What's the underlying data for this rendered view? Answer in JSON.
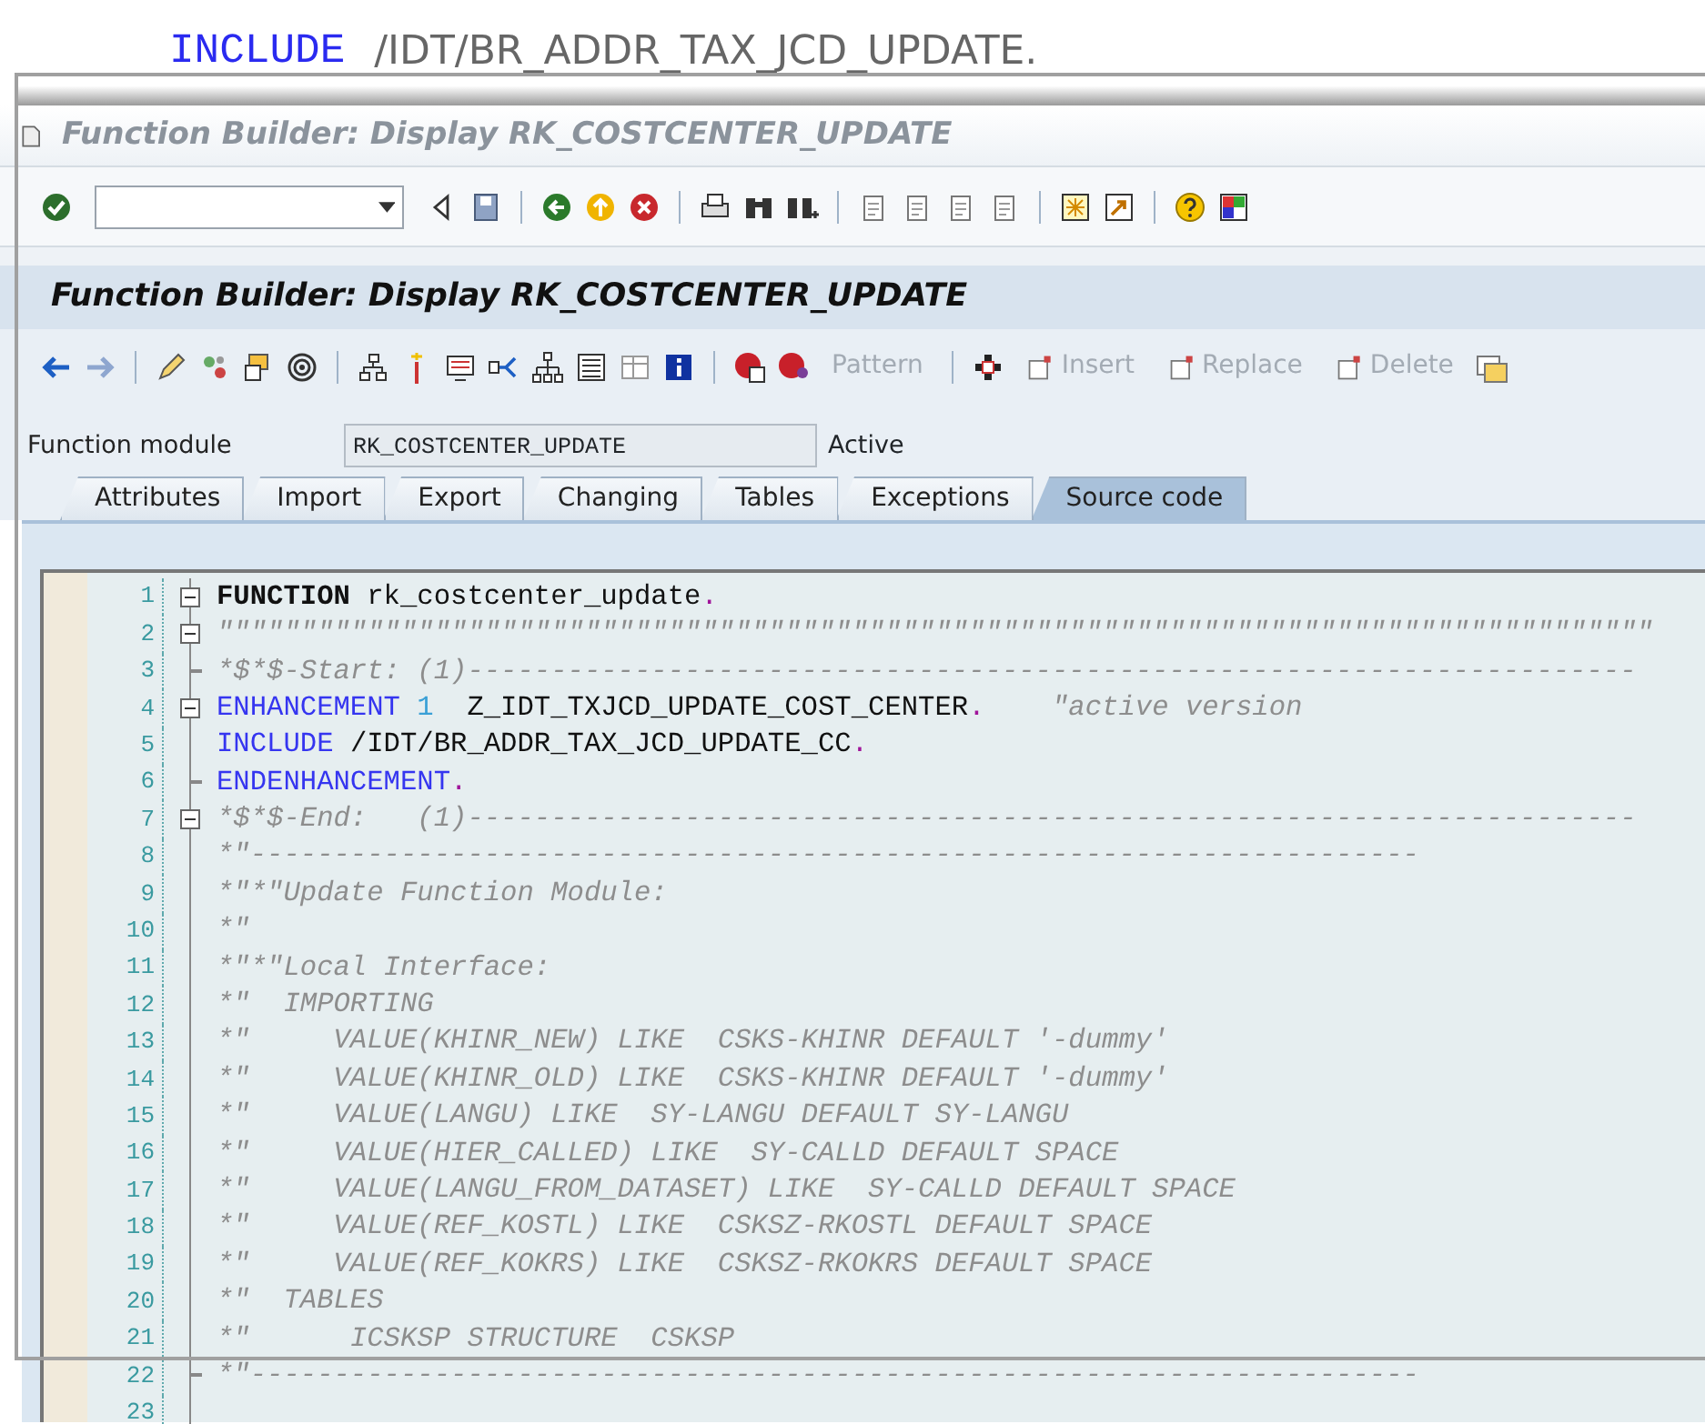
{
  "overlay_text": {
    "keyword": "INCLUDE",
    "rest": "/IDT/BR_ADDR_TAX_JCD_UPDATE."
  },
  "window": {
    "title": "Function Builder: Display RK_COSTCENTER_UPDATE"
  },
  "app_title": "Function Builder: Display RK_COSTCENTER_UPDATE",
  "app_toolbar": {
    "text_buttons": [
      {
        "label": "Pattern",
        "disabled": true
      },
      {
        "label": "Insert",
        "disabled": true
      },
      {
        "label": "Replace",
        "disabled": true
      },
      {
        "label": "Delete",
        "disabled": true
      }
    ]
  },
  "header_field": {
    "label": "Function module",
    "value": "RK_COSTCENTER_UPDATE",
    "status": "Active"
  },
  "tabs": [
    {
      "label": "Attributes",
      "selected": false
    },
    {
      "label": "Import",
      "selected": false
    },
    {
      "label": "Export",
      "selected": false
    },
    {
      "label": "Changing",
      "selected": false
    },
    {
      "label": "Tables",
      "selected": false
    },
    {
      "label": "Exceptions",
      "selected": false
    },
    {
      "label": "Source code",
      "selected": true
    }
  ],
  "code_lines": [
    {
      "number": "1",
      "fold_box": true,
      "fold_tick": false,
      "segments": [
        {
          "kind": "statement",
          "text": "FUNCTION"
        },
        {
          "kind": "plain",
          "text": " rk_costcenter_update"
        },
        {
          "kind": "punct",
          "text": "."
        }
      ]
    },
    {
      "number": "2",
      "fold_box": true,
      "fold_tick": false,
      "segments": [
        {
          "kind": "comment",
          "text": "\"\"\"\"\"\"\"\"\"\"\"\"\"\"\"\"\"\"\"\"\"\"\"\"\"\"\"\"\"\"\"\"\"\"\"\"\"\"\"\"\"\"\"\"\"\"\"\"\"\"\"\"\"\"\"\"\"\"\"\"\"\"\"\"\"\"\"\"\"\"\"\"\"\"\"\"\"\"\"\"\"\"\"\"\"\""
        }
      ]
    },
    {
      "number": "3",
      "fold_box": false,
      "fold_tick": true,
      "segments": [
        {
          "kind": "comment",
          "text": "*$*$-Start: (1)----------------------------------------------------------------------"
        }
      ]
    },
    {
      "number": "4",
      "fold_box": true,
      "fold_tick": false,
      "segments": [
        {
          "kind": "keyword",
          "text": "ENHANCEMENT"
        },
        {
          "kind": "number",
          "text": " 1"
        },
        {
          "kind": "plain",
          "text": "  Z_IDT_TXJCD_UPDATE_COST_CENTER"
        },
        {
          "kind": "punct",
          "text": "."
        },
        {
          "kind": "comment",
          "text": "    \"active version"
        }
      ]
    },
    {
      "number": "5",
      "fold_box": false,
      "fold_tick": false,
      "segments": [
        {
          "kind": "keyword",
          "text": "INCLUDE"
        },
        {
          "kind": "plain",
          "text": " /IDT/BR_ADDR_TAX_JCD_UPDATE_CC"
        },
        {
          "kind": "punct",
          "text": "."
        }
      ]
    },
    {
      "number": "6",
      "fold_box": false,
      "fold_tick": true,
      "segments": [
        {
          "kind": "keyword",
          "text": "ENDENHANCEMENT"
        },
        {
          "kind": "punct",
          "text": "."
        }
      ]
    },
    {
      "number": "7",
      "fold_box": true,
      "fold_tick": false,
      "segments": [
        {
          "kind": "comment",
          "text": "*$*$-End:   (1)----------------------------------------------------------------------"
        }
      ]
    },
    {
      "number": "8",
      "fold_box": false,
      "fold_tick": false,
      "segments": [
        {
          "kind": "comment",
          "text": "*\"----------------------------------------------------------------------"
        }
      ]
    },
    {
      "number": "9",
      "fold_box": false,
      "fold_tick": false,
      "segments": [
        {
          "kind": "comment",
          "text": "*\"*\"Update Function Module:"
        }
      ]
    },
    {
      "number": "10",
      "fold_box": false,
      "fold_tick": false,
      "segments": [
        {
          "kind": "comment",
          "text": "*\""
        }
      ]
    },
    {
      "number": "11",
      "fold_box": false,
      "fold_tick": false,
      "segments": [
        {
          "kind": "comment",
          "text": "*\"*\"Local Interface:"
        }
      ]
    },
    {
      "number": "12",
      "fold_box": false,
      "fold_tick": false,
      "segments": [
        {
          "kind": "comment",
          "text": "*\"  IMPORTING"
        }
      ]
    },
    {
      "number": "13",
      "fold_box": false,
      "fold_tick": false,
      "segments": [
        {
          "kind": "comment",
          "text": "*\"     VALUE(KHINR_NEW) LIKE  CSKS-KHINR DEFAULT '-dummy'"
        }
      ]
    },
    {
      "number": "14",
      "fold_box": false,
      "fold_tick": false,
      "segments": [
        {
          "kind": "comment",
          "text": "*\"     VALUE(KHINR_OLD) LIKE  CSKS-KHINR DEFAULT '-dummy'"
        }
      ]
    },
    {
      "number": "15",
      "fold_box": false,
      "fold_tick": false,
      "segments": [
        {
          "kind": "comment",
          "text": "*\"     VALUE(LANGU) LIKE  SY-LANGU DEFAULT SY-LANGU"
        }
      ]
    },
    {
      "number": "16",
      "fold_box": false,
      "fold_tick": false,
      "segments": [
        {
          "kind": "comment",
          "text": "*\"     VALUE(HIER_CALLED) LIKE  SY-CALLD DEFAULT SPACE"
        }
      ]
    },
    {
      "number": "17",
      "fold_box": false,
      "fold_tick": false,
      "segments": [
        {
          "kind": "comment",
          "text": "*\"     VALUE(LANGU_FROM_DATASET) LIKE  SY-CALLD DEFAULT SPACE"
        }
      ]
    },
    {
      "number": "18",
      "fold_box": false,
      "fold_tick": false,
      "segments": [
        {
          "kind": "comment",
          "text": "*\"     VALUE(REF_KOSTL) LIKE  CSKSZ-RKOSTL DEFAULT SPACE"
        }
      ]
    },
    {
      "number": "19",
      "fold_box": false,
      "fold_tick": false,
      "segments": [
        {
          "kind": "comment",
          "text": "*\"     VALUE(REF_KOKRS) LIKE  CSKSZ-RKOKRS DEFAULT SPACE"
        }
      ]
    },
    {
      "number": "20",
      "fold_box": false,
      "fold_tick": false,
      "segments": [
        {
          "kind": "comment",
          "text": "*\"  TABLES"
        }
      ]
    },
    {
      "number": "21",
      "fold_box": false,
      "fold_tick": false,
      "segments": [
        {
          "kind": "comment",
          "text": "*\"      ICSKSP STRUCTURE  CSKSP"
        }
      ]
    },
    {
      "number": "22",
      "fold_box": false,
      "fold_tick": true,
      "segments": [
        {
          "kind": "comment",
          "text": "*\"----------------------------------------------------------------------"
        }
      ]
    },
    {
      "number": "23",
      "fold_box": false,
      "fold_tick": false
    }
  ]
}
